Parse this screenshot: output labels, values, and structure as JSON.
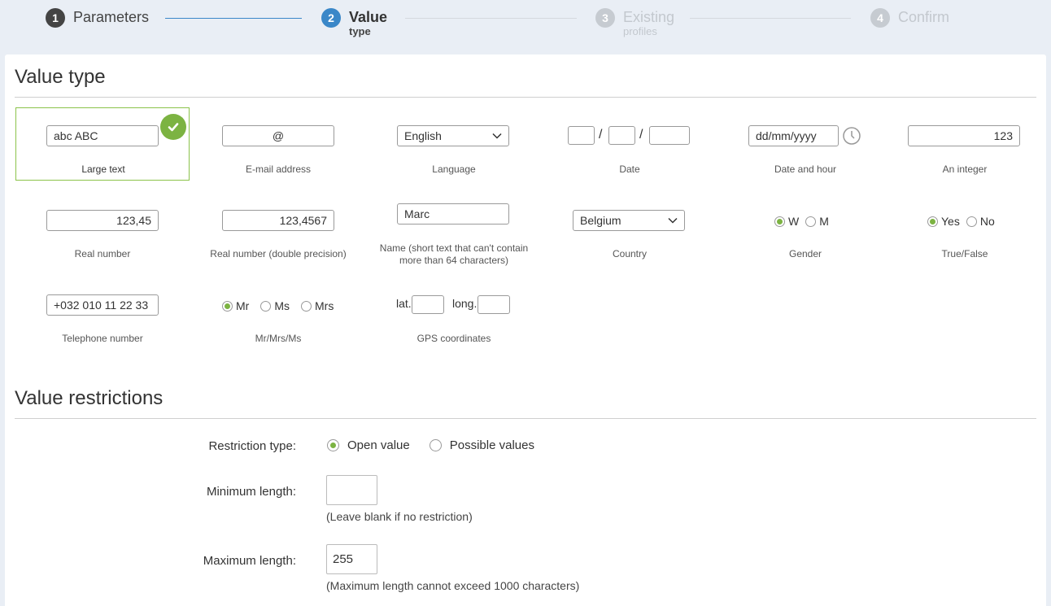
{
  "stepper": {
    "steps": [
      {
        "num": "1",
        "label": "Parameters",
        "sub": "",
        "state": "done"
      },
      {
        "num": "2",
        "label": "Value",
        "sub": "type",
        "state": "active"
      },
      {
        "num": "3",
        "label": "Existing",
        "sub": "profiles",
        "state": "todo"
      },
      {
        "num": "4",
        "label": "Confirm",
        "sub": "",
        "state": "todo"
      }
    ]
  },
  "value_type": {
    "title": "Value type",
    "items": {
      "large_text": {
        "value": "abc ABC",
        "caption": "Large text"
      },
      "email": {
        "value": "@",
        "caption": "E-mail address"
      },
      "language": {
        "value": "English",
        "caption": "Language"
      },
      "date": {
        "sep1": "/",
        "sep2": "/",
        "caption": "Date"
      },
      "datetime": {
        "value": "dd/mm/yyyy",
        "caption": "Date and hour"
      },
      "integer": {
        "value": "123",
        "caption": "An integer"
      },
      "real": {
        "value": "123,45",
        "caption": "Real number"
      },
      "real_double": {
        "value": "123,4567",
        "caption": "Real number (double precision)"
      },
      "name": {
        "value": "Marc",
        "caption_line1": "Name (short text that can't contain",
        "caption_line2": "more than 64 characters)"
      },
      "country": {
        "value": "Belgium",
        "caption": "Country"
      },
      "gender": {
        "opt1": "W",
        "opt2": "M",
        "caption": "Gender"
      },
      "truefalse": {
        "opt1": "Yes",
        "opt2": "No",
        "caption": "True/False"
      },
      "telephone": {
        "value": "+032 010 11 22 33",
        "caption": "Telephone number"
      },
      "title_choice": {
        "opt1": "Mr",
        "opt2": "Ms",
        "opt3": "Mrs",
        "caption": "Mr/Mrs/Ms"
      },
      "gps": {
        "lat": "lat.",
        "long": "long.",
        "caption": "GPS coordinates"
      }
    }
  },
  "restrictions": {
    "title": "Value restrictions",
    "type_label": "Restriction type:",
    "open_value": "Open value",
    "possible_values": "Possible values",
    "min_label": "Minimum length:",
    "min_value": "",
    "min_help": "(Leave blank if no restriction)",
    "max_label": "Maximum length:",
    "max_value": "255",
    "max_help": "(Maximum length cannot exceed 1000 characters)"
  },
  "colors": {
    "accent_blue": "#3a87c8",
    "accent_green": "#7cb342"
  }
}
